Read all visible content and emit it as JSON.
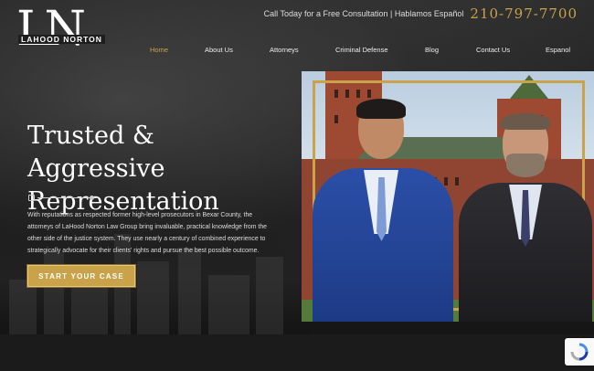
{
  "header": {
    "logo_letters": "LN",
    "logo_name": "LAHOOD NORTON",
    "cta_text": "Call Today for a Free Consultation | Hablamos Español",
    "phone": "210-797-7700"
  },
  "nav": {
    "items": [
      {
        "label": "Home",
        "active": true
      },
      {
        "label": "About Us",
        "active": false
      },
      {
        "label": "Attorneys",
        "active": false
      },
      {
        "label": "Criminal Defense",
        "active": false
      },
      {
        "label": "Blog",
        "active": false
      },
      {
        "label": "Contact Us",
        "active": false
      },
      {
        "label": "Espanol",
        "active": false
      }
    ]
  },
  "hero": {
    "headline_line1": "Trusted & Aggressive",
    "headline_line2": "Representation",
    "body": "With reputations as respected former high-level prosecutors in Bexar County, the attorneys of LaHood Norton Law Group bring invaluable, practical knowledge from the other side of the justice system. They use nearly a century of combined experience to strategically advocate for their clients' rights and pursue the best possible outcome.",
    "button_label": "START YOUR CASE"
  },
  "colors": {
    "accent": "#c9a24a",
    "background": "#1e1e1e"
  },
  "icons": {
    "recaptcha": "recaptcha-icon"
  }
}
